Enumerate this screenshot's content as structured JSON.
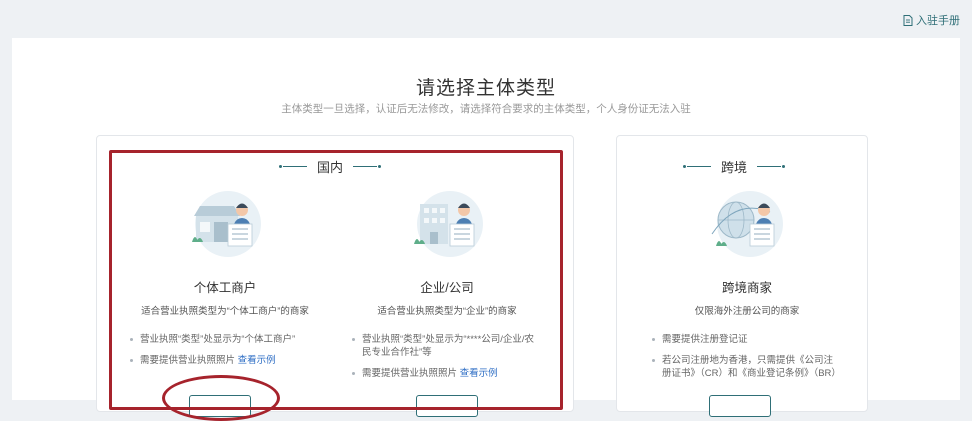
{
  "topbar": {
    "manual_label": "入驻手册",
    "manual_icon": "document-icon"
  },
  "page": {
    "title": "请选择主体类型",
    "subtitle": "主体类型一旦选择，认证后无法修改，请选择符合要求的主体类型，个人身份证无法入驻"
  },
  "domestic": {
    "header": "国内",
    "options": [
      {
        "name": "个体工商户",
        "desc": "适合营业执照类型为“个体工商户”的商家",
        "bullets": [
          "营业执照“类型”处显示为“个体工商户”",
          "需要提供营业执照照片"
        ],
        "example_label": "查看示例"
      },
      {
        "name": "企业/公司",
        "desc": "适合营业执照类型为“企业”的商家",
        "bullets": [
          "营业执照“类型”处显示为“****公司/企业/农民专业合作社”等",
          "需要提供营业执照照片"
        ],
        "example_label": "查看示例"
      }
    ]
  },
  "cross_border": {
    "header": "跨境",
    "option": {
      "name": "跨境商家",
      "desc": "仅限海外注册公司的商家",
      "bullets": [
        "需要提供注册登记证",
        "若公司注册地为香港，只需提供《公司注册证书》（CR）和《商业登记条例》（BR）"
      ]
    }
  },
  "colors": {
    "accent": "#2f6f77",
    "annotation": "#a6232c",
    "link": "#2d6dc4",
    "background": "#eef1f4"
  }
}
